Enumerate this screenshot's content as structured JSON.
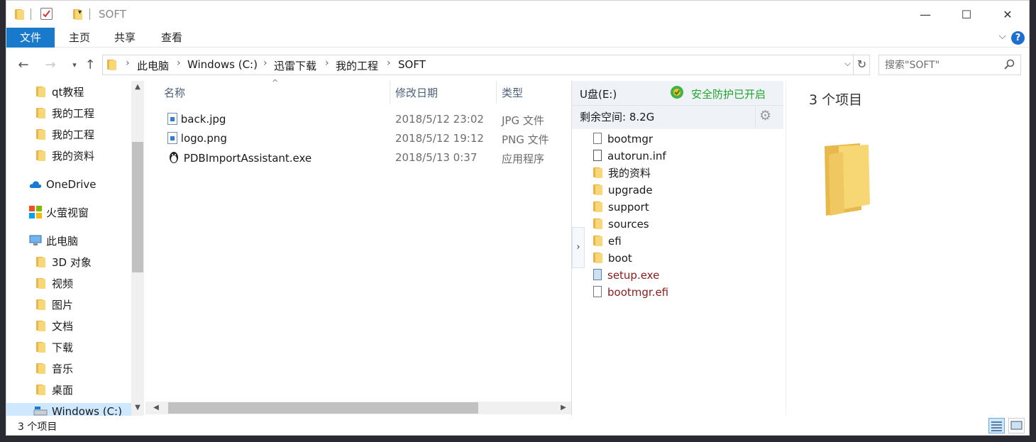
{
  "window": {
    "title": "SOFT",
    "caption": {
      "minimize": "—",
      "maximize": "☐",
      "close": "✕"
    }
  },
  "ribbon": {
    "tabs": [
      "文件",
      "主页",
      "共享",
      "查看"
    ],
    "expand": "⌵",
    "help": "?"
  },
  "address": {
    "breadcrumbs": [
      "此电脑",
      "Windows (C:)",
      "迅雷下载",
      "我的工程",
      "SOFT"
    ],
    "separator": "›"
  },
  "search": {
    "placeholder": "搜索\"SOFT\""
  },
  "nav": {
    "items": [
      {
        "label": "qt教程",
        "icon": "folder-icon"
      },
      {
        "label": "我的工程",
        "icon": "folder-icon"
      },
      {
        "label": "我的工程",
        "icon": "folder-icon"
      },
      {
        "label": "我的资料",
        "icon": "folder-icon"
      },
      {
        "label": "OneDrive",
        "icon": "cloud-icon"
      },
      {
        "label": "火萤视窗",
        "icon": "windows-icon"
      },
      {
        "label": "此电脑",
        "icon": "computer-icon"
      },
      {
        "label": "3D 对象",
        "icon": "3d-objects-icon"
      },
      {
        "label": "视频",
        "icon": "video-folder-icon"
      },
      {
        "label": "图片",
        "icon": "pictures-folder-icon"
      },
      {
        "label": "文档",
        "icon": "documents-folder-icon"
      },
      {
        "label": "下载",
        "icon": "downloads-folder-icon"
      },
      {
        "label": "音乐",
        "icon": "music-folder-icon"
      },
      {
        "label": "桌面",
        "icon": "desktop-folder-icon"
      },
      {
        "label": "Windows (C:)",
        "icon": "drive-icon"
      }
    ]
  },
  "filelist": {
    "columns": [
      "名称",
      "修改日期",
      "类型"
    ],
    "rows": [
      {
        "name": "back.jpg",
        "date": "2018/5/12 23:02",
        "type": "JPG 文件",
        "icon": "image-file-icon"
      },
      {
        "name": "logo.png",
        "date": "2018/5/12 19:12",
        "type": "PNG 文件",
        "icon": "image-file-icon"
      },
      {
        "name": "PDBImportAssistant.exe",
        "date": "2018/5/13 0:37",
        "type": "应用程序",
        "icon": "app-icon"
      }
    ]
  },
  "usb": {
    "drive": "U盘(E:)",
    "protection": "安全防护已开启",
    "free_space": "剩余空间: 8.2G",
    "items": [
      {
        "name": "bootmgr",
        "kind": "file",
        "color": "#1a1a1a"
      },
      {
        "name": "autorun.inf",
        "kind": "settings-file",
        "color": "#1a1a1a"
      },
      {
        "name": "我的资料",
        "kind": "folder",
        "color": "#1a1a1a"
      },
      {
        "name": "upgrade",
        "kind": "folder",
        "color": "#1a1a1a"
      },
      {
        "name": "support",
        "kind": "folder",
        "color": "#1a1a1a"
      },
      {
        "name": "sources",
        "kind": "folder",
        "color": "#1a1a1a"
      },
      {
        "name": "efi",
        "kind": "folder",
        "color": "#1a1a1a"
      },
      {
        "name": "boot",
        "kind": "folder",
        "color": "#1a1a1a"
      },
      {
        "name": "setup.exe",
        "kind": "app",
        "color": "#8b1a1a"
      },
      {
        "name": "bootmgr.efi",
        "kind": "file",
        "color": "#8b1a1a"
      }
    ]
  },
  "preview": {
    "count_label": "3 个项目"
  },
  "status": {
    "count_label": "3 个项目"
  },
  "colors": {
    "accent": "#1979ca",
    "protect_green": "#22a32a",
    "system_file_red": "#8b1a1a"
  }
}
